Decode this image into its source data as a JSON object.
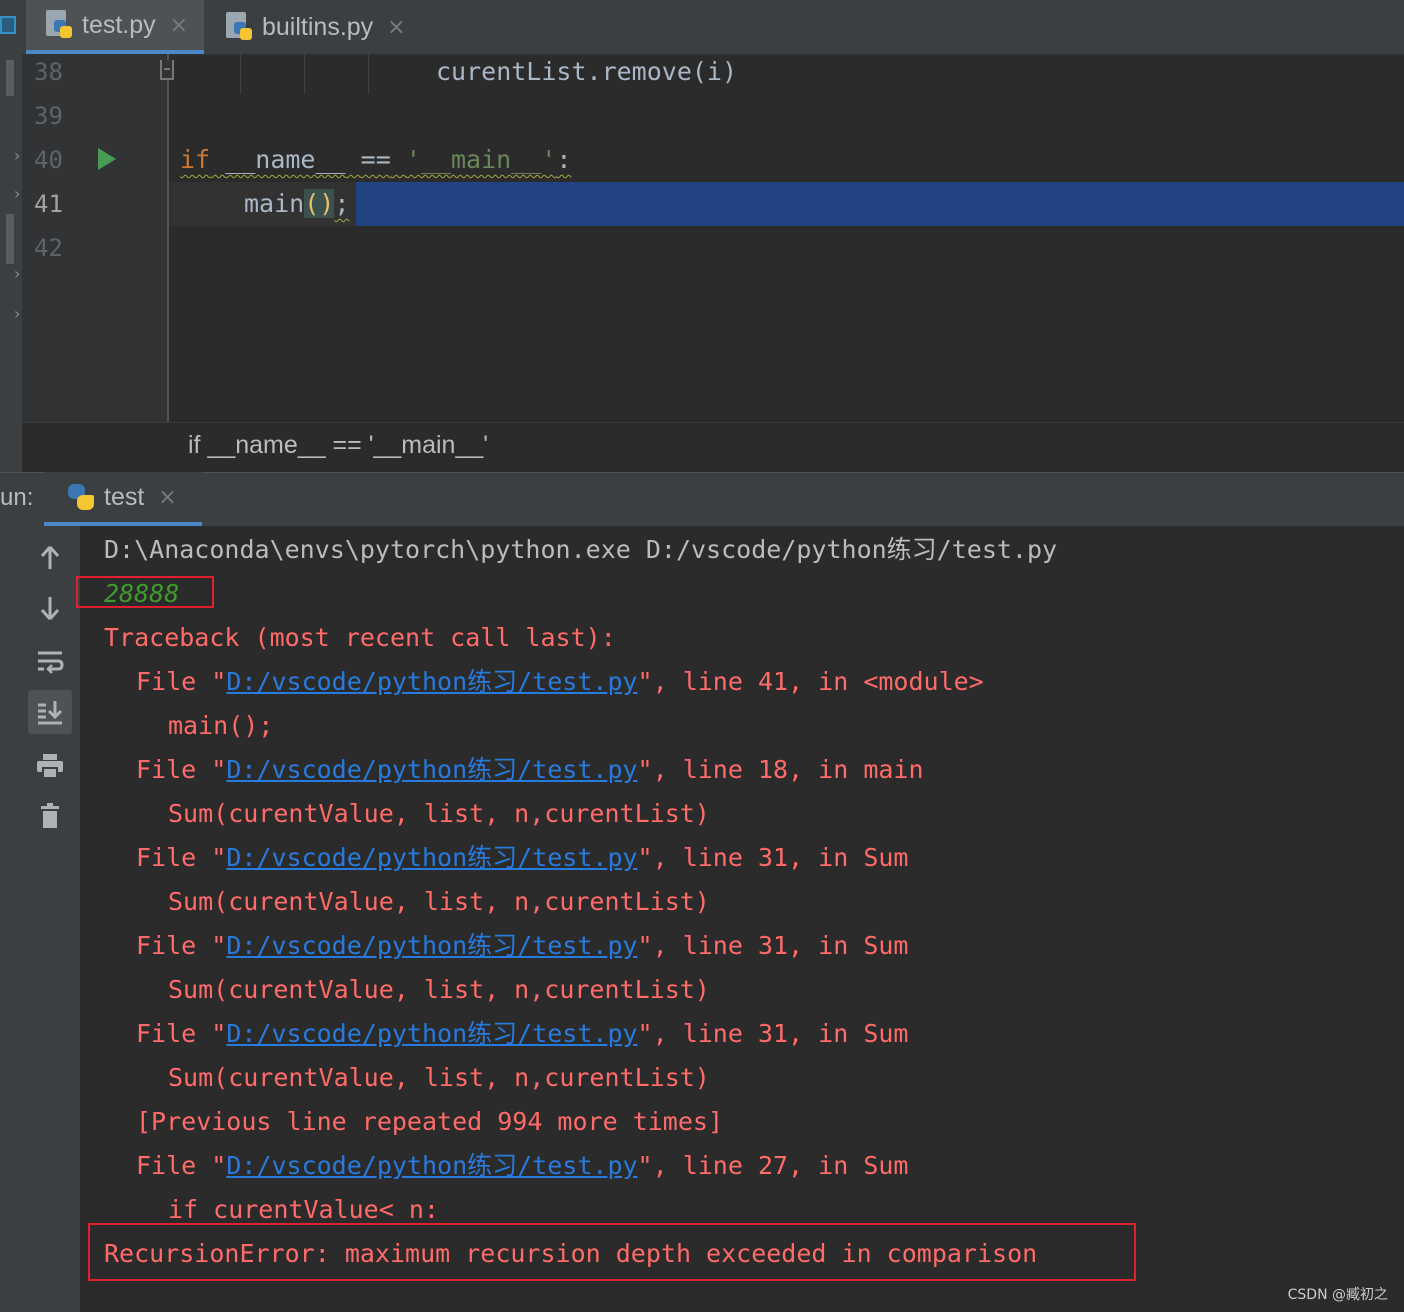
{
  "editor_tabs": [
    {
      "label": "test.py",
      "close": "×",
      "active": true
    },
    {
      "label": "builtins.py",
      "close": "×",
      "active": false
    }
  ],
  "editor": {
    "line_numbers": [
      "38",
      "39",
      "40",
      "41",
      "42"
    ],
    "current_line": "41",
    "code": {
      "l38": "curentList.remove(i)",
      "l40_kw": "if",
      "l40_name": "__name__",
      "l40_op": "==",
      "l40_str": "'__main__'",
      "l40_colon": ":",
      "l41_call": "main",
      "l41_parens": "()",
      "l41_semi": ";"
    },
    "breadcrumb": "if __name__ == '__main__'"
  },
  "run_panel": {
    "label": "un:",
    "tab_label": "test",
    "tab_close": "×",
    "toolbar_icons": [
      "up-arrow-icon",
      "down-arrow-icon",
      "soft-wrap-icon",
      "scroll-to-end-icon",
      "print-icon",
      "trash-icon"
    ],
    "console": {
      "command": "D:\\Anaconda\\envs\\pytorch\\python.exe D:/vscode/python练习/test.py",
      "output": "28888",
      "traceback_header": "Traceback (most recent call last):",
      "file_prefix": "File \"",
      "file_link": "D:/vscode/python练习/test.py",
      "frames": [
        {
          "suffix": "\", line 41, in <module>",
          "code": "main();"
        },
        {
          "suffix": "\", line 18, in main",
          "code": "Sum(curentValue, list, n,curentList)"
        },
        {
          "suffix": "\", line 31, in Sum",
          "code": "Sum(curentValue, list, n,curentList)"
        },
        {
          "suffix": "\", line 31, in Sum",
          "code": "Sum(curentValue, list, n,curentList)"
        },
        {
          "suffix": "\", line 31, in Sum",
          "code": "Sum(curentValue, list, n,curentList)"
        }
      ],
      "repeated": "[Previous line repeated 994 more times]",
      "last_frame": {
        "suffix": "\", line 27, in Sum",
        "code": "if curentValue< n:"
      },
      "error": "RecursionError: maximum recursion depth exceeded in comparison"
    }
  },
  "watermark": "CSDN @臧初之",
  "colors": {
    "keyword": "#cc7832",
    "string": "#6a8759",
    "error": "#ff6b68",
    "link": "#287bde",
    "output": "#3e9c2b",
    "selection": "#214283",
    "highlight_box": "#e0202e"
  }
}
